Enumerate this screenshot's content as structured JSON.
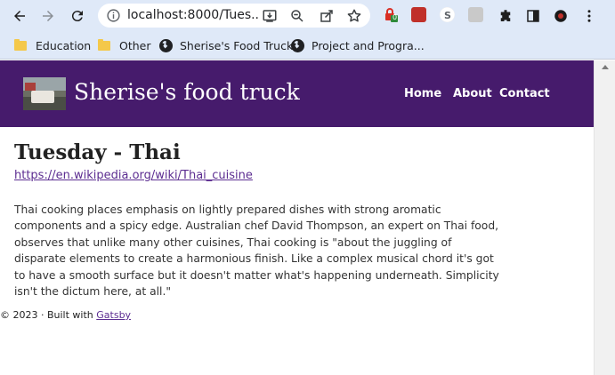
{
  "browser": {
    "url": "localhost:8000/Tues...",
    "bookmarks": [
      {
        "label": "Education",
        "icon": "folder-icon"
      },
      {
        "label": "Other",
        "icon": "folder-icon"
      },
      {
        "label": "Sherise's Food Truck",
        "icon": "globe-icon"
      },
      {
        "label": "Project and Progra...",
        "icon": "globe-icon"
      }
    ],
    "extension_badge": "0"
  },
  "site": {
    "title": "Sherise's food truck",
    "nav": {
      "home": "Home",
      "about": "About",
      "contact": "Contact"
    },
    "header_color": "#461b6c"
  },
  "content": {
    "heading": "Tuesday - Thai",
    "link": "https://en.wikipedia.org/wiki/Thai_cuisine",
    "paragraph": "Thai cooking places emphasis on lightly prepared dishes with strong aromatic components and a spicy edge. Australian chef David Thompson, an expert on Thai food, observes that unlike many other cuisines, Thai cooking is \"about the juggling of disparate elements to create a harmonious finish. Like a complex musical chord it's got to have a smooth surface but it doesn't matter what's happening underneath. Simplicity isn't the dictum here, at all.\""
  },
  "footer": {
    "prefix": "© 2023 · Built with",
    "link": "Gatsby"
  }
}
